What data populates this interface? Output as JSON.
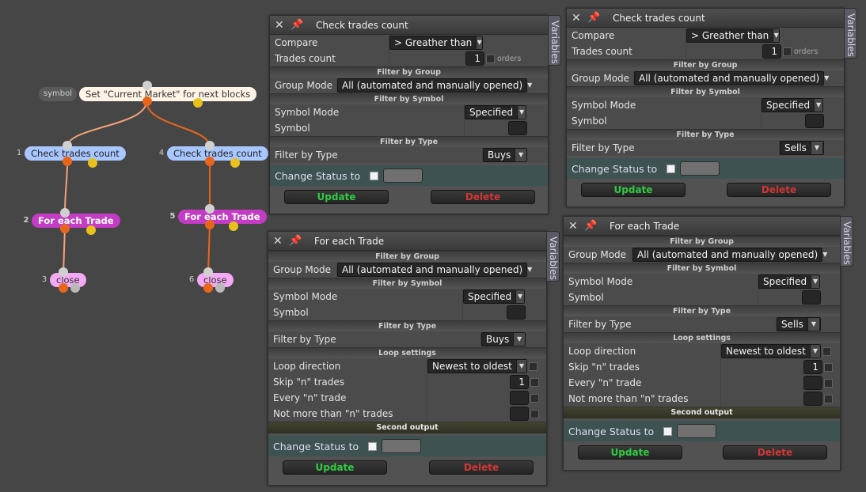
{
  "graph": {
    "nodes": [
      {
        "num": "",
        "tag": "symbol",
        "label": "Set \"Current Market\" for next blocks"
      },
      {
        "num": "1",
        "label": "Check trades count"
      },
      {
        "num": "4",
        "label": "Check trades count"
      },
      {
        "num": "2",
        "label": "For each Trade"
      },
      {
        "num": "5",
        "label": "For each Trade"
      },
      {
        "num": "3",
        "label": "close"
      },
      {
        "num": "6",
        "label": "close"
      }
    ]
  },
  "common": {
    "variables_tab": "Variables",
    "update_label": "Update",
    "delete_label": "Delete",
    "change_status_label": "Change Status to",
    "filter_by_group": "Filter by Group",
    "filter_by_symbol": "Filter by Symbol",
    "filter_by_type": "Filter by Type",
    "loop_settings": "Loop settings",
    "second_output": "Second output",
    "group_mode_label": "Group Mode",
    "symbol_mode_label": "Symbol Mode",
    "symbol_label": "Symbol",
    "filter_type_label": "Filter by Type",
    "loop_direction_label": "Loop direction",
    "skip_label": "Skip \"n\" trades",
    "every_label": "Every \"n\" trade",
    "not_more_label": "Not more than \"n\" trades",
    "compare_label": "Compare",
    "trades_count_label": "Trades count",
    "orders_label": "orders"
  },
  "panels": {
    "check1": {
      "title": "Check trades count",
      "compare": "> Greather than",
      "trades_count": "1",
      "group_mode": "All (automated and manually opened)",
      "symbol_mode": "Specified",
      "type": "Buys"
    },
    "check2": {
      "title": "Check trades count",
      "compare": "> Greather than",
      "trades_count": "1",
      "group_mode": "All (automated and manually opened)",
      "symbol_mode": "Specified",
      "type": "Sells"
    },
    "each1": {
      "title": "For each Trade",
      "group_mode": "All (automated and manually opened)",
      "symbol_mode": "Specified",
      "type": "Buys",
      "loop_direction": "Newest to oldest",
      "skip": "1"
    },
    "each2": {
      "title": "For each Trade",
      "group_mode": "All (automated and manually opened)",
      "symbol_mode": "Specified",
      "type": "Sells",
      "loop_direction": "Newest to oldest",
      "skip": "1"
    }
  },
  "colors": {
    "background": "#464646",
    "link": "#e8661b",
    "update": "#2fcc42",
    "delete": "#d23636",
    "for_each_node": "#c43bc4",
    "check_node": "#a9c7ff",
    "close_node": "#f3a9f3"
  }
}
